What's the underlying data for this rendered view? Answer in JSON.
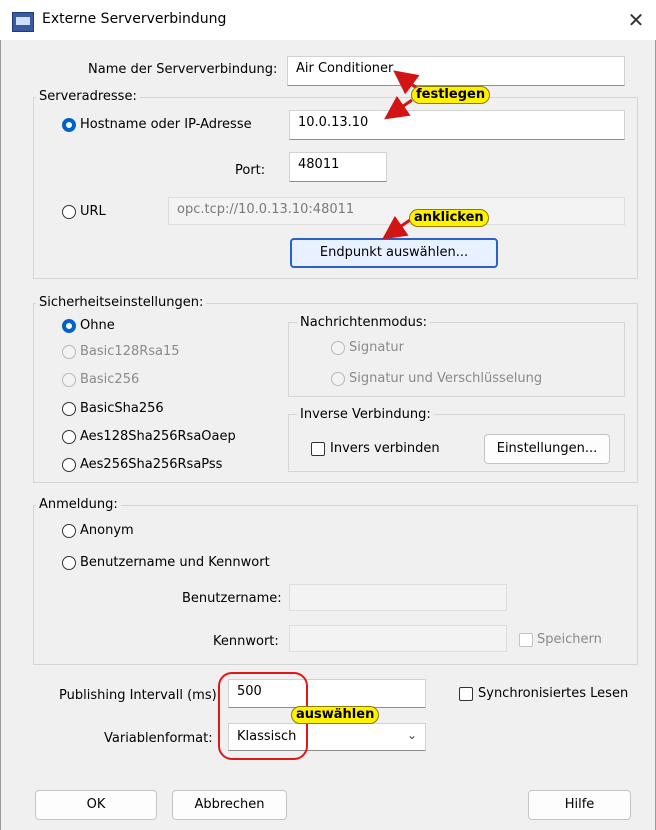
{
  "window": {
    "title": "Externe Serververbindung",
    "close_glyph": "✕"
  },
  "connection_name": {
    "label": "Name der Serververbindung:",
    "value": "Air Conditioner"
  },
  "server_address": {
    "group_label": "Serveradresse:",
    "hostname_label": "Hostname oder IP-Adresse",
    "hostname_value": "10.0.13.10",
    "port_label": "Port:",
    "port_value": "48011",
    "url_label": "URL",
    "url_value": "opc.tcp://10.0.13.10:48011",
    "endpoint_button": "Endpunkt auswählen..."
  },
  "security": {
    "group_label": "Sicherheitseinstellungen:",
    "options": [
      "Ohne",
      "Basic128Rsa15",
      "Basic256",
      "BasicSha256",
      "Aes128Sha256RsaOaep",
      "Aes256Sha256RsaPss"
    ],
    "message_mode": {
      "label": "Nachrichtenmodus:",
      "sign": "Signatur",
      "sign_encrypt": "Signatur und Verschlüsselung"
    },
    "reverse": {
      "label": "Inverse Verbindung:",
      "checkbox": "Invers verbinden",
      "settings_button": "Einstellungen..."
    }
  },
  "login": {
    "group_label": "Anmeldung:",
    "anonymous": "Anonym",
    "user_password": "Benutzername und Kennwort",
    "username_label": "Benutzername:",
    "password_label": "Kennwort:",
    "save_label": "Speichern"
  },
  "publishing": {
    "label": "Publishing Intervall (ms)",
    "value": "500",
    "sync_read": "Synchronisiertes Lesen"
  },
  "format": {
    "label": "Variablenformat:",
    "value": "Klassisch"
  },
  "buttons": {
    "ok": "OK",
    "cancel": "Abbrechen",
    "help": "Hilfe"
  },
  "annotations": {
    "set": "festlegen",
    "click": "anklicken",
    "select": "auswählen"
  },
  "colors": {
    "annotation_fill": "#fff200",
    "arrow": "#d21414",
    "highlight_box": "#e01818",
    "radio_selected": "#0061c8"
  }
}
